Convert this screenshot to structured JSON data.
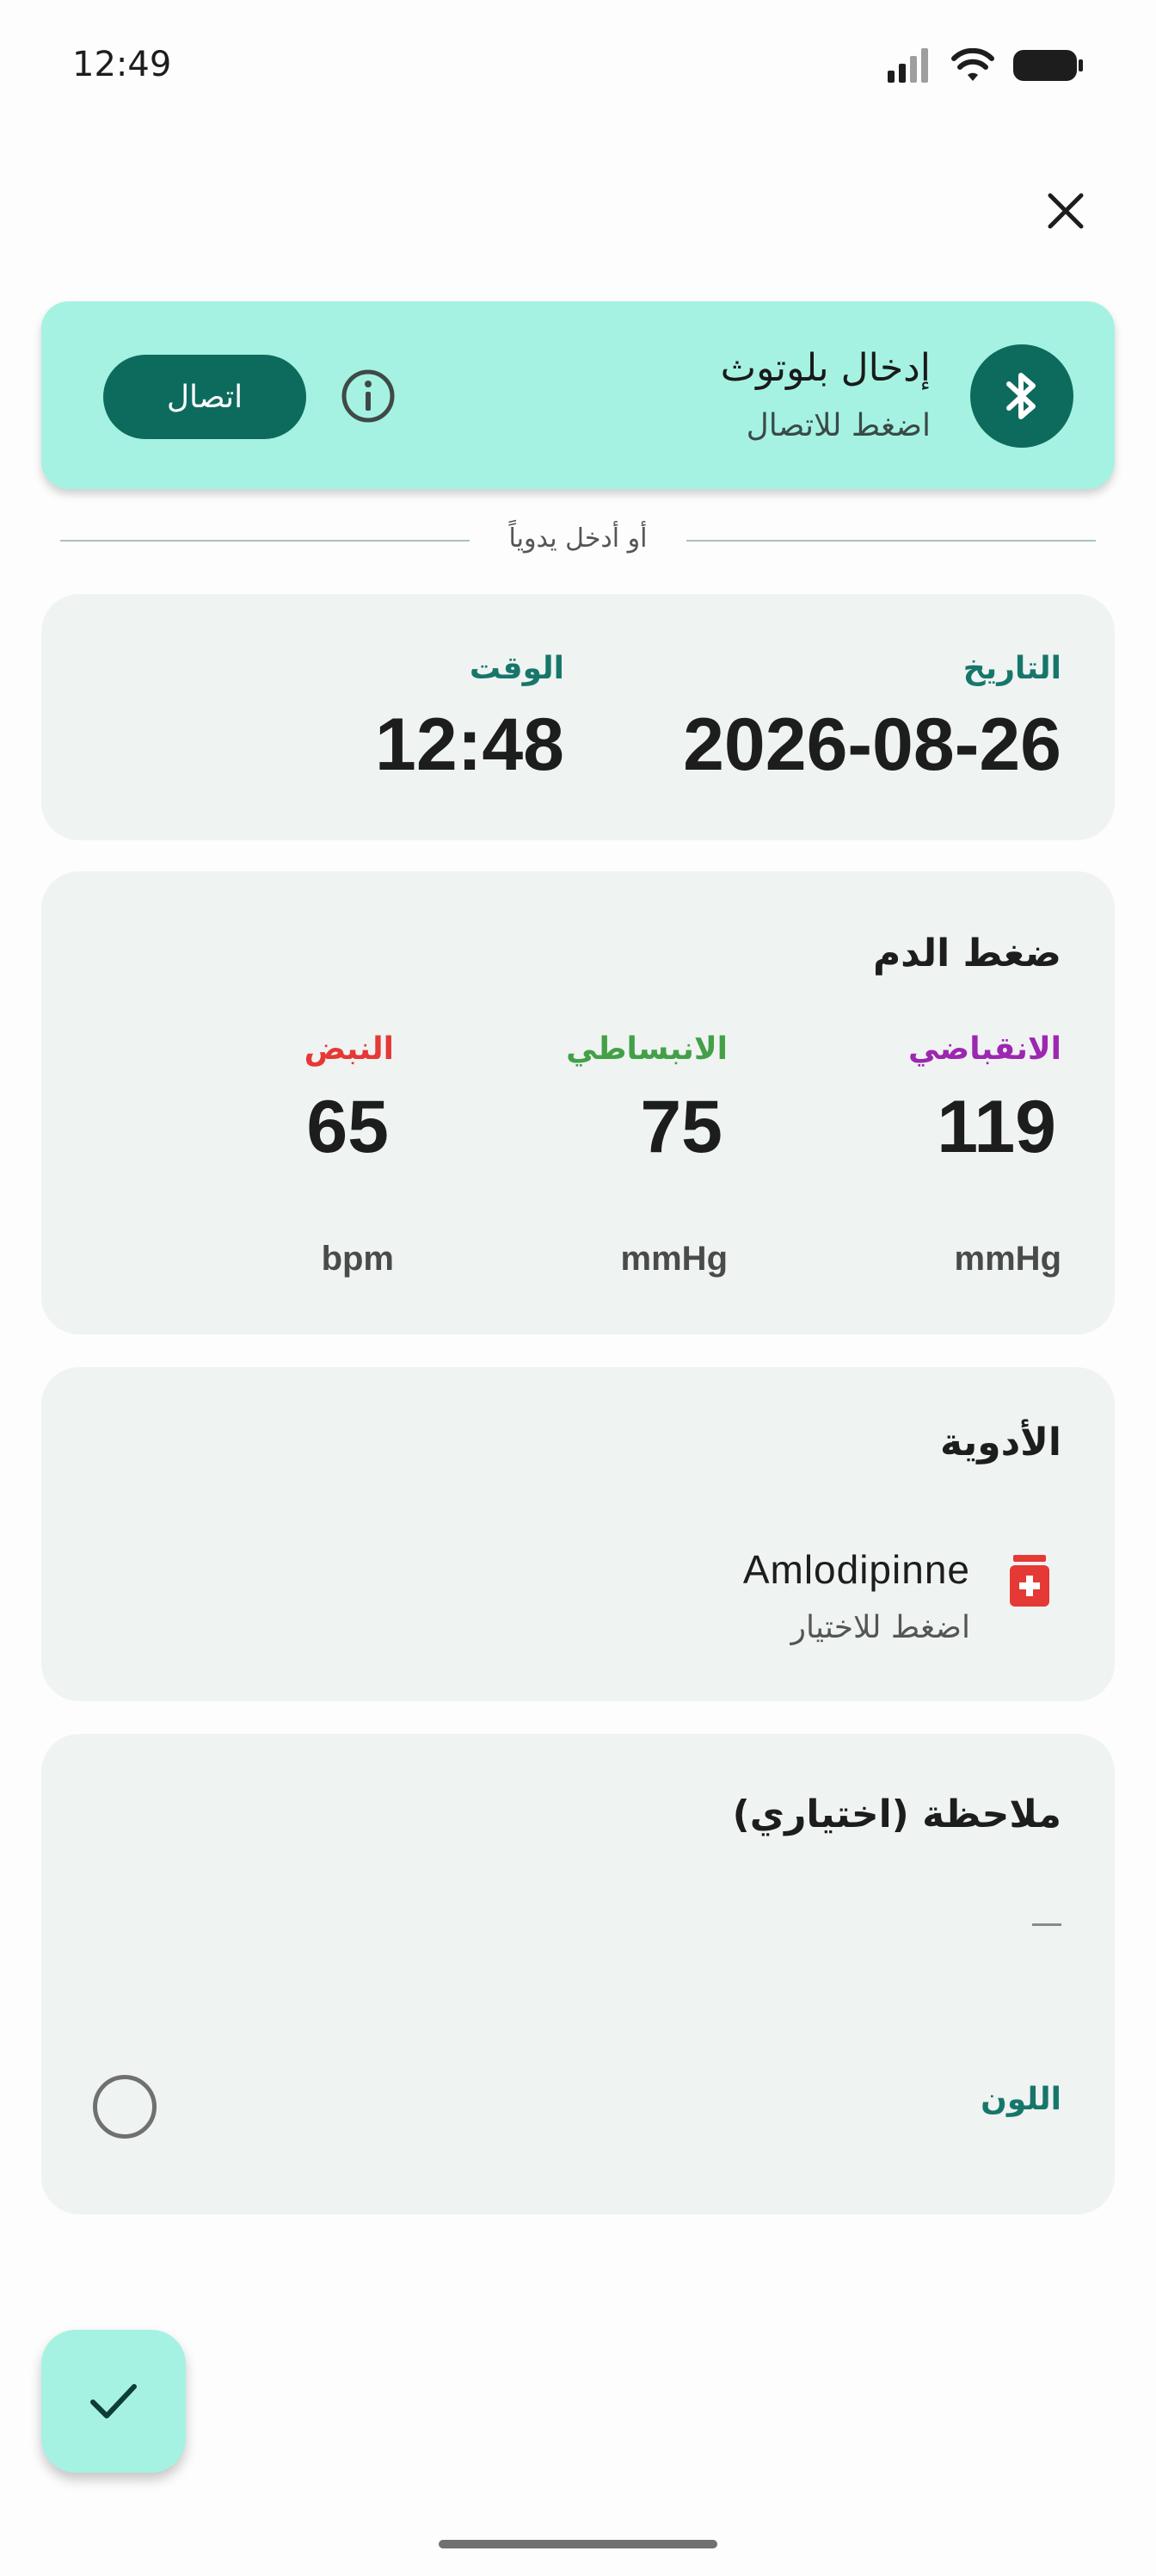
{
  "status_bar": {
    "time": "12:49"
  },
  "bluetooth": {
    "title": "إدخال بلوتوث",
    "subtitle": "اضغط للاتصال",
    "connect_label": "اتصال"
  },
  "divider_text": "أو أدخل يدوياً",
  "datetime": {
    "date_label": "التاريخ",
    "date_value": "2026-08-26",
    "time_label": "الوقت",
    "time_value": "12:48"
  },
  "blood_pressure": {
    "title": "ضغط الدم",
    "systolic": {
      "label": "الانقباضي",
      "value": "119",
      "unit": "mmHg",
      "color": "#9c27b0"
    },
    "diastolic": {
      "label": "الانبساطي",
      "value": "75",
      "unit": "mmHg",
      "color": "#43a047"
    },
    "pulse": {
      "label": "النبض",
      "value": "65",
      "unit": "bpm",
      "color": "#e53935"
    }
  },
  "medications": {
    "title": "الأدوية",
    "item_name": "Amlodipinne",
    "item_hint": "اضغط للاختيار",
    "icon_color": "#e53935"
  },
  "note": {
    "title": "ملاحظة (اختياري)",
    "color_label": "اللون"
  },
  "colors": {
    "accent": "#0d6b5e",
    "accent_light": "#a5f2e2",
    "card_bg": "#eff3f2"
  }
}
